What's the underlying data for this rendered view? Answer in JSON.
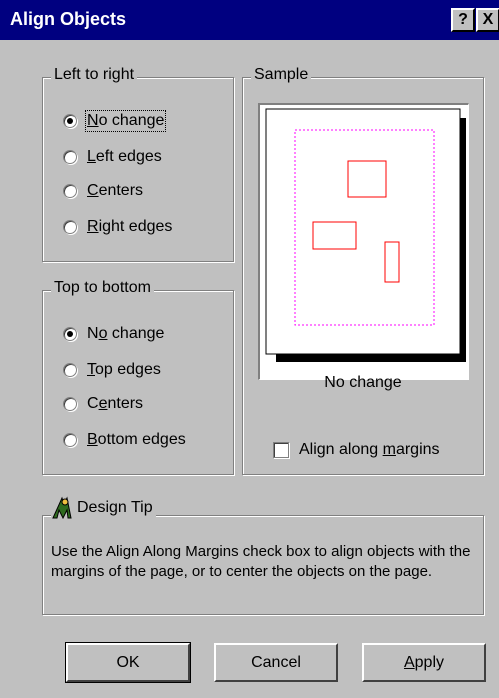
{
  "window": {
    "title": "Align Objects",
    "help_label": "?",
    "close_label": "X"
  },
  "left_to_right": {
    "legend": "Left to right",
    "options": [
      {
        "pre": "",
        "u": "N",
        "post": "o change",
        "selected": true
      },
      {
        "pre": "",
        "u": "L",
        "post": "eft edges",
        "selected": false
      },
      {
        "pre": "",
        "u": "C",
        "post": "enters",
        "selected": false
      },
      {
        "pre": "",
        "u": "R",
        "post": "ight edges",
        "selected": false
      }
    ]
  },
  "top_to_bottom": {
    "legend": "Top to bottom",
    "options": [
      {
        "pre": "N",
        "u": "o",
        "post": " change",
        "selected": true
      },
      {
        "pre": "",
        "u": "T",
        "post": "op edges",
        "selected": false
      },
      {
        "pre": "C",
        "u": "e",
        "post": "nters",
        "selected": false
      },
      {
        "pre": "",
        "u": "B",
        "post": "ottom edges",
        "selected": false
      }
    ]
  },
  "sample": {
    "legend": "Sample",
    "caption": "No change"
  },
  "margins_checkbox": {
    "pre": "Align along ",
    "u": "m",
    "post": "argins",
    "checked": false
  },
  "design_tip": {
    "legend": "Design Tip",
    "text": "Use the Align Along Margins check box to align objects with the margins of the page, or to center the objects on the page."
  },
  "buttons": {
    "ok": "OK",
    "cancel": "Cancel",
    "apply_u": "A",
    "apply_post": "pply"
  },
  "colors": {
    "title_bar": "#000080",
    "dialog_bg": "#c0c0c0",
    "shape_stroke": "#ff0000",
    "margin_guide": "#ff00ff"
  }
}
